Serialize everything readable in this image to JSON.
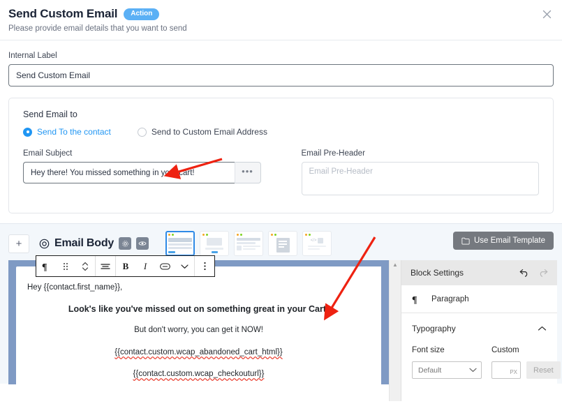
{
  "header": {
    "title": "Send Custom Email",
    "badge": "Action",
    "subtitle": "Please provide email details that you want to send",
    "close_icon": "close-icon"
  },
  "internal_label": {
    "label": "Internal Label",
    "value": "Send Custom Email"
  },
  "send_email_card": {
    "title": "Send Email to",
    "options": [
      {
        "label": "Send To the contact",
        "selected": true
      },
      {
        "label": "Send to Custom Email Address",
        "selected": false
      }
    ],
    "subject": {
      "label": "Email Subject",
      "value": "Hey there! You missed something in your cart!",
      "more_button": "•••"
    },
    "preheader": {
      "label": "Email Pre-Header",
      "value": "",
      "placeholder": "Email Pre-Header"
    }
  },
  "email_body": {
    "add_button": "+",
    "title": "Email Body",
    "settings_icon": "gear-icon",
    "preview_icon": "eye-icon",
    "thumbnails": [
      {
        "name": "layout-basic",
        "selected": true
      },
      {
        "name": "layout-image",
        "selected": false
      },
      {
        "name": "layout-article",
        "selected": false
      },
      {
        "name": "layout-document",
        "selected": false
      },
      {
        "name": "layout-code",
        "selected": false
      }
    ],
    "use_template_button": "Use Email Template",
    "template_icon": "folder-icon"
  },
  "editor_toolbar": {
    "items": [
      {
        "name": "paragraph-icon",
        "glyph": "¶"
      },
      {
        "name": "drag-handle-icon",
        "glyph": "⁙"
      },
      {
        "name": "move-updown-icon",
        "glyph": "⌃"
      },
      {
        "name": "align-icon",
        "glyph": "≡"
      },
      {
        "name": "bold-icon",
        "glyph": "B"
      },
      {
        "name": "italic-icon",
        "glyph": "I"
      },
      {
        "name": "link-icon",
        "glyph": "⚭"
      },
      {
        "name": "chevron-down-icon",
        "glyph": "⌄"
      },
      {
        "name": "more-options-icon",
        "glyph": "⋮"
      }
    ]
  },
  "editor_content": {
    "lines": [
      {
        "text": "Hey {{contact.first_name}},",
        "align": "left",
        "bold": false,
        "spellcheck_error": false
      },
      {
        "text": "Look's like you've missed out on something great in your Cart!",
        "align": "center",
        "bold": true,
        "spellcheck_error": false
      },
      {
        "text": "But don't worry, you can get it NOW!",
        "align": "center",
        "bold": false,
        "spellcheck_error": false
      },
      {
        "text": "{{contact.custom.wcap_abandoned_cart_html}}",
        "align": "center",
        "bold": false,
        "spellcheck_error": true
      },
      {
        "text": "{{contact.custom.wcap_checkouturl}}",
        "align": "center",
        "bold": false,
        "spellcheck_error": true
      }
    ]
  },
  "block_settings": {
    "title": "Block Settings",
    "undo_icon": "undo-icon",
    "redo_icon": "redo-icon",
    "block_type": "Paragraph",
    "block_icon": "paragraph-icon",
    "typography": {
      "title": "Typography",
      "collapse_icon": "chevron-up-icon",
      "font_size_label": "Font size",
      "font_size_value": "Default",
      "custom_label": "Custom",
      "custom_value": "",
      "custom_unit": "PX",
      "reset_label": "Reset"
    }
  },
  "annotations": {
    "arrow_color": "#ee2211",
    "arrows": [
      {
        "name": "arrow-to-email-subject"
      },
      {
        "name": "arrow-to-email-body-editor"
      }
    ]
  }
}
